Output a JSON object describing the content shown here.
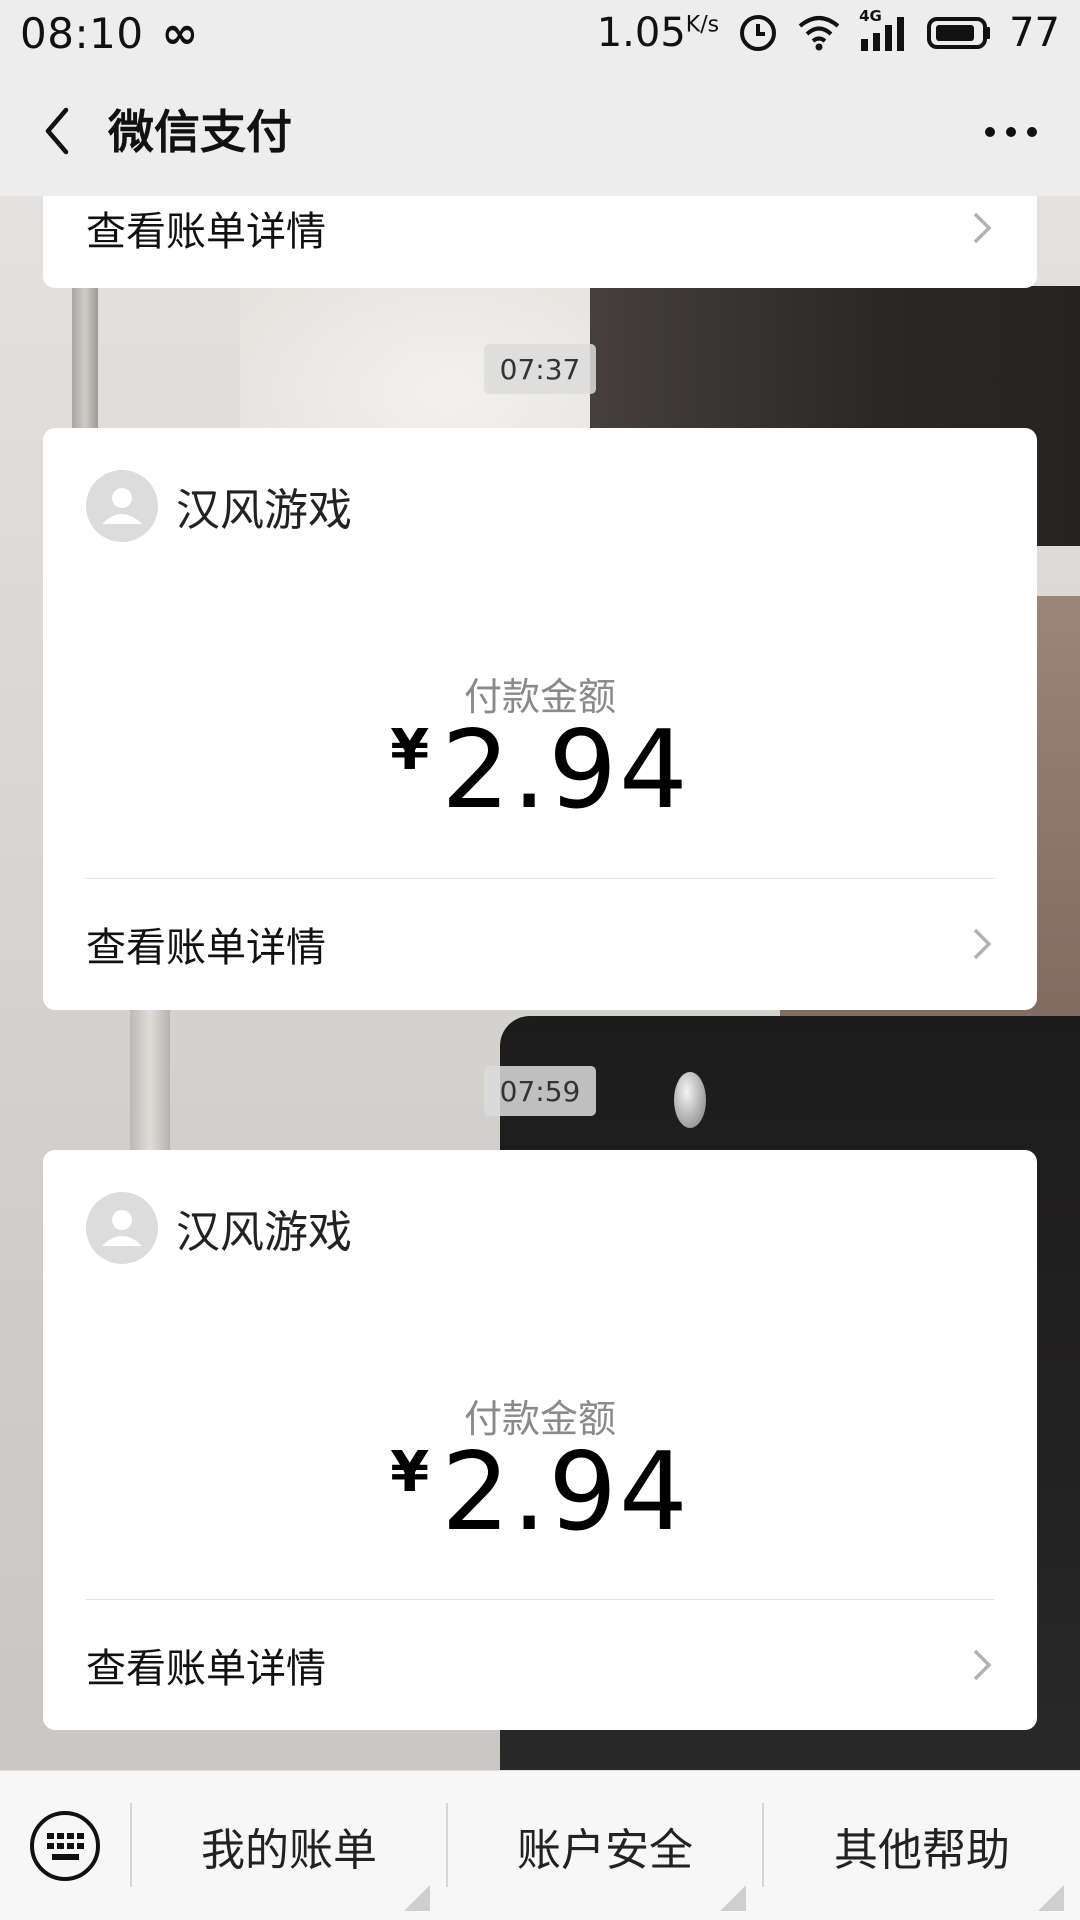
{
  "status_bar": {
    "time": "08:10",
    "infinity_symbol": "∞",
    "net_speed_value": "1.05",
    "net_speed_unit": "K/s",
    "signal_label": "4G",
    "battery_percent": "77"
  },
  "navbar": {
    "title": "微信支付"
  },
  "top_partial_card": {
    "details_label": "查看账单详情"
  },
  "transactions": [
    {
      "time": "07:37",
      "merchant": "汉风游戏",
      "amount_label": "付款金额",
      "currency": "¥",
      "amount": "2.94",
      "details_label": "查看账单详情"
    },
    {
      "time": "07:59",
      "merchant": "汉风游戏",
      "amount_label": "付款金额",
      "currency": "¥",
      "amount": "2.94",
      "details_label": "查看账单详情"
    }
  ],
  "bottom_menu": {
    "items": [
      "我的账单",
      "账户安全",
      "其他帮助"
    ]
  }
}
